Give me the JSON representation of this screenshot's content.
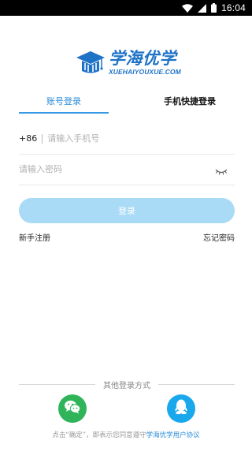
{
  "status_bar": {
    "time": "16:04"
  },
  "logo": {
    "name": "学海优学",
    "sub": "XUEHAIYOUXUE.COM"
  },
  "tabs": [
    {
      "label": "账号登录",
      "active": true
    },
    {
      "label": "手机快捷登录",
      "active": false
    }
  ],
  "phone_field": {
    "prefix": "+86",
    "placeholder": "请输入手机号",
    "value": ""
  },
  "password_field": {
    "placeholder": "请输入密码",
    "value": ""
  },
  "login_button": {
    "label": "登录"
  },
  "links": {
    "register": "新手注册",
    "forgot": "忘记密码"
  },
  "other_login": {
    "title": "其他登录方式",
    "options": [
      "wechat-icon",
      "qq-icon"
    ]
  },
  "agreement": {
    "prefix": "点击“确定”，即表示您同意遵守",
    "link": "学海优学用户协议"
  },
  "colors": {
    "accent": "#2a8bd8",
    "button": "#a9daf6",
    "wechat": "#2fb45a",
    "qq": "#19a8ec"
  }
}
